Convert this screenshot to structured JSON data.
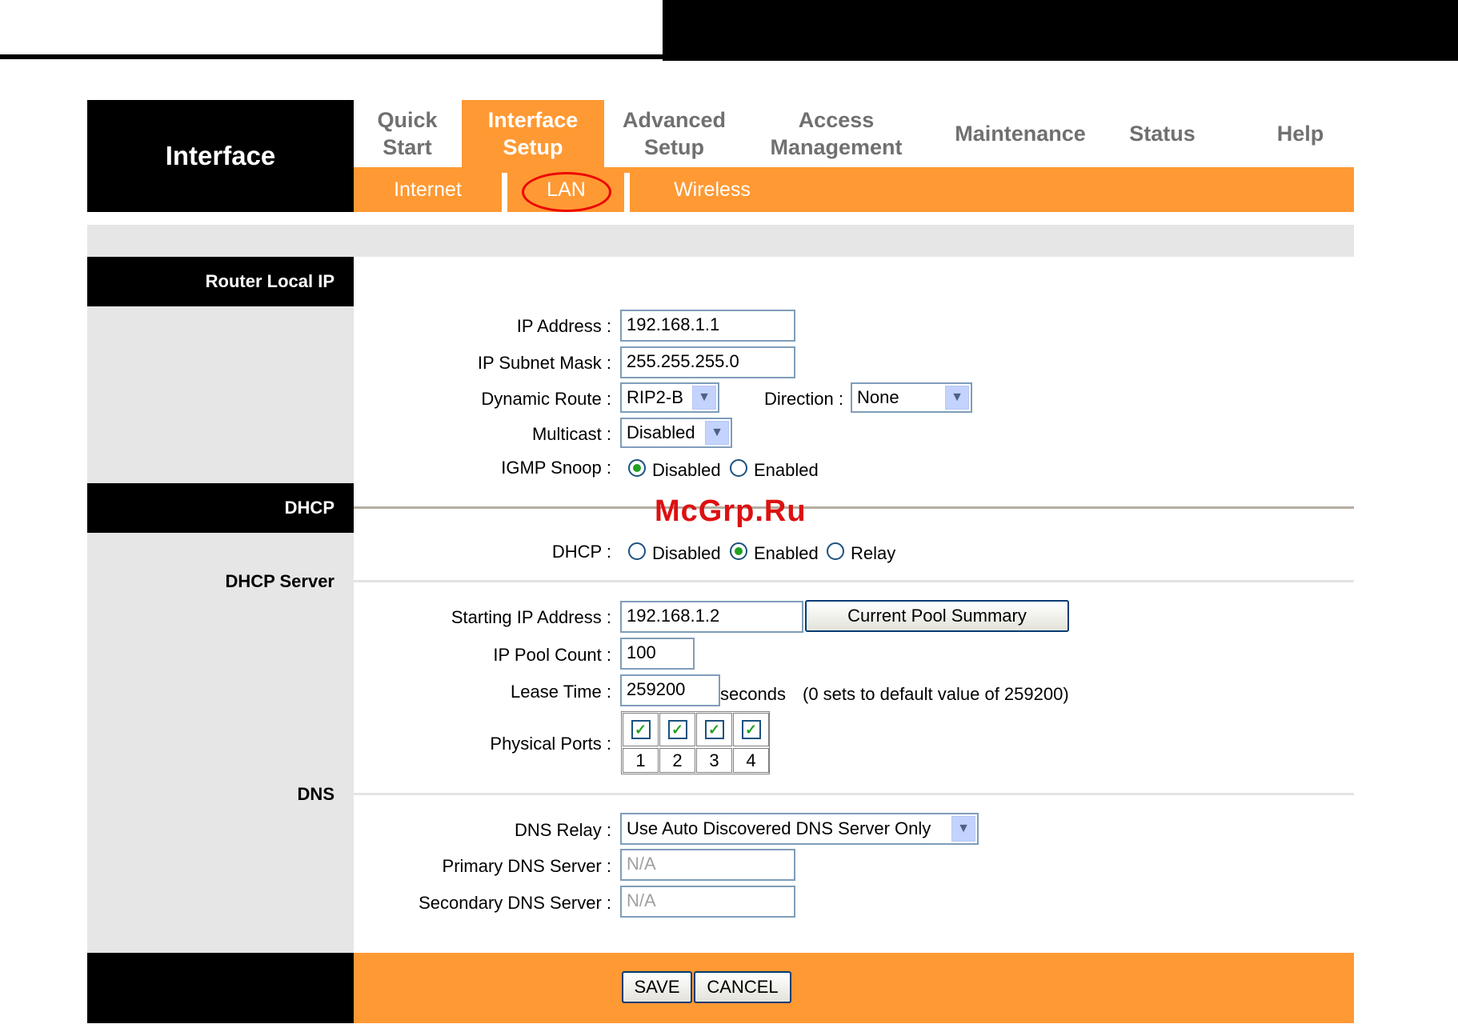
{
  "brand": "Interface",
  "nav": [
    {
      "label": "Quick\nStart",
      "active": false
    },
    {
      "label": "Interface\nSetup",
      "active": true
    },
    {
      "label": "Advanced\nSetup",
      "active": false
    },
    {
      "label": "Access\nManagement",
      "active": false
    },
    {
      "label": "Maintenance",
      "active": false
    },
    {
      "label": "Status",
      "active": false
    },
    {
      "label": "Help",
      "active": false
    }
  ],
  "subnav": {
    "internet": "Internet",
    "lan": "LAN",
    "wireless": "Wireless"
  },
  "sections": {
    "router_local_ip": "Router Local IP",
    "dhcp": "DHCP",
    "dhcp_server": "DHCP Server",
    "dns": "DNS"
  },
  "router": {
    "ip_label": "IP Address :",
    "ip_value": "192.168.1.1",
    "mask_label": "IP Subnet Mask :",
    "mask_value": "255.255.255.0",
    "route_label": "Dynamic Route :",
    "route_value": "RIP2-B",
    "direction_label": "Direction :",
    "direction_value": "None",
    "multicast_label": "Multicast :",
    "multicast_value": "Disabled",
    "igmp_label": "IGMP Snoop :",
    "igmp_disabled": "Disabled",
    "igmp_enabled": "Enabled"
  },
  "dhcp": {
    "label": "DHCP :",
    "disabled": "Disabled",
    "enabled": "Enabled",
    "relay": "Relay",
    "start_label": "Starting IP Address :",
    "start_value": "192.168.1.2",
    "pool_button": "Current Pool Summary",
    "count_label": "IP Pool Count :",
    "count_value": "100",
    "lease_label": "Lease Time :",
    "lease_value": "259200",
    "lease_unit": "seconds",
    "lease_note": "(0 sets to default value of 259200)",
    "ports_label": "Physical Ports :",
    "ports": [
      "1",
      "2",
      "3",
      "4"
    ]
  },
  "dns": {
    "relay_label": "DNS Relay :",
    "relay_value": "Use Auto Discovered DNS Server Only",
    "primary_label": "Primary DNS Server :",
    "primary_value": "N/A",
    "secondary_label": "Secondary DNS Server :",
    "secondary_value": "N/A"
  },
  "buttons": {
    "save": "SAVE",
    "cancel": "CANCEL"
  },
  "watermark": "McGrp.Ru",
  "colors": {
    "accent": "#ff9933",
    "panel": "#e6e6e6",
    "dark": "#000000"
  }
}
